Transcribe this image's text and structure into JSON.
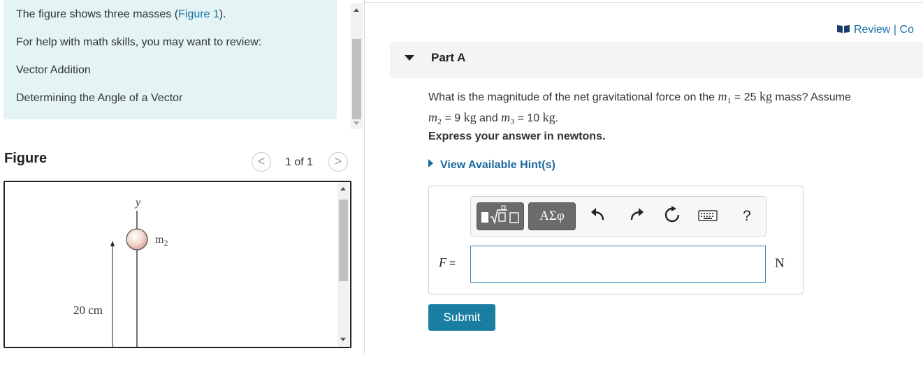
{
  "info": {
    "intro_text": "The figure shows three masses (",
    "figure_link": "Figure 1",
    "intro_end": ").",
    "help_text": "For help with math skills, you may want to review:",
    "links": [
      "Vector Addition",
      "Determining the Angle of a Vector"
    ]
  },
  "figure": {
    "title": "Figure",
    "pager": "1 of 1",
    "prev_glyph": "<",
    "next_glyph": ">",
    "axis_y": "y",
    "mass_label_base": "m",
    "mass_label_sub": "2",
    "distance_label": "20 cm"
  },
  "review": {
    "label": "Review | Co"
  },
  "part": {
    "label": "Part A"
  },
  "question": {
    "q1": "What is the magnitude of the net gravitational force on the ",
    "m1_sub": "1",
    "eq1": " = 25 ",
    "kg": "kg",
    "mid": " mass? Assume",
    "m2_sub": "2",
    "eq2": " = 9 ",
    "and": " and ",
    "m3_sub": "3",
    "eq3": " = 10 ",
    "end": ".",
    "m": "m"
  },
  "express": "Express your answer in newtons.",
  "hint": "View Available Hint(s)",
  "toolbar": {
    "greek_label": "ΑΣφ",
    "help_label": "?"
  },
  "answer": {
    "label": "F",
    "equals": " =",
    "value": "",
    "unit": "N"
  },
  "submit": "Submit",
  "colors": {
    "info_bg": "#e4f4f5",
    "link": "#1a73a8",
    "submit_bg": "#1a7ea3",
    "input_border": "#2a8ab8"
  }
}
